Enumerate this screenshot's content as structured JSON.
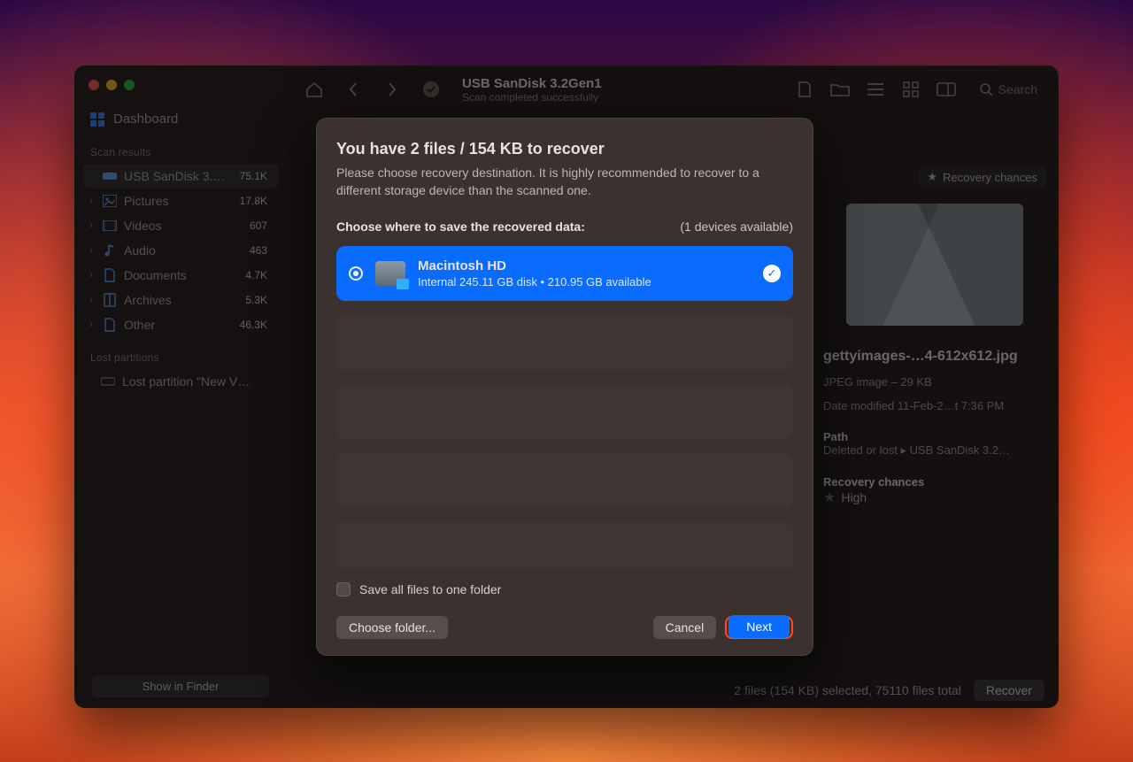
{
  "sidebar": {
    "dashboard_label": "Dashboard",
    "scan_results_label": "Scan results",
    "items": [
      {
        "label": "USB SanDisk 3.…",
        "count": "75.1K",
        "icon": "disk"
      },
      {
        "label": "Pictures",
        "count": "17.8K",
        "icon": "picture"
      },
      {
        "label": "Videos",
        "count": "607",
        "icon": "video"
      },
      {
        "label": "Audio",
        "count": "463",
        "icon": "audio"
      },
      {
        "label": "Documents",
        "count": "4.7K",
        "icon": "document"
      },
      {
        "label": "Archives",
        "count": "5.3K",
        "icon": "archive"
      },
      {
        "label": "Other",
        "count": "46.3K",
        "icon": "other"
      }
    ],
    "lost_partitions_label": "Lost partitions",
    "lost_partition_item": "Lost partition \"New V…",
    "show_in_finder": "Show in Finder"
  },
  "toolbar": {
    "title": "USB SanDisk 3.2Gen1",
    "subtitle": "Scan completed successfully",
    "search_placeholder": "Search"
  },
  "detail": {
    "recovery_chances_pill": "Recovery chances",
    "file_name": "gettyimages-…4-612x612.jpg",
    "type_size": "JPEG image – 29 KB",
    "date_modified": "Date modified 11-Feb-2…t 7:36 PM",
    "path_label": "Path",
    "path_value": "Deleted or lost ▸ USB SanDisk 3.2…",
    "recovery_chances_label": "Recovery chances",
    "recovery_chances_value": "High"
  },
  "statusbar": {
    "summary": "2 files (154 KB) selected, 75110 files total",
    "recover_label": "Recover"
  },
  "modal": {
    "title": "You have 2 files / 154 KB to recover",
    "hint": "Please choose recovery destination. It is highly recommended to recover to a different storage device than the scanned one.",
    "choose_label": "Choose where to save the recovered data:",
    "devices_available": "(1 devices available)",
    "destination": {
      "name": "Macintosh HD",
      "details": "Internal 245.11 GB disk • 210.95 GB available"
    },
    "save_all_label": "Save all files to one folder",
    "choose_folder_label": "Choose folder...",
    "cancel_label": "Cancel",
    "next_label": "Next"
  }
}
